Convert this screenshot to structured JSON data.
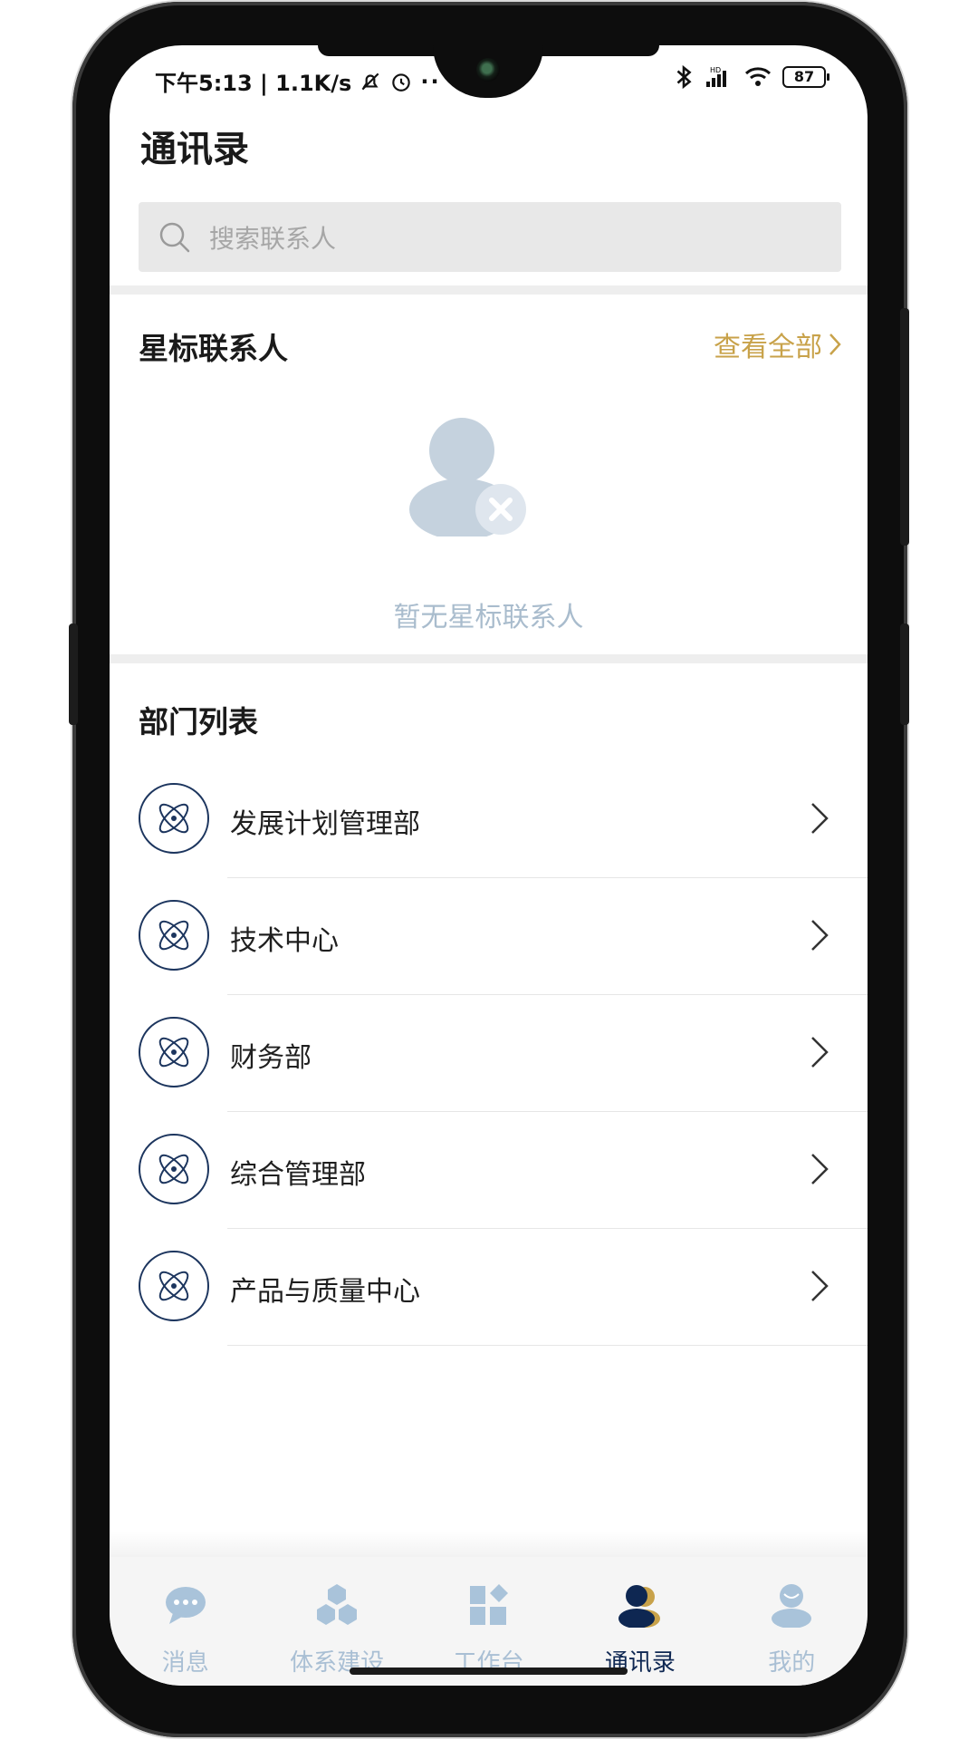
{
  "status_bar": {
    "time_speed": "下午5:13 | 1.1K/s",
    "icons": [
      "mute-bell-icon",
      "alarm-icon",
      "more-dots-icon",
      "bluetooth-icon",
      "signal-hd-icon",
      "wifi-icon"
    ],
    "battery": "87"
  },
  "header": {
    "title": "通讯录"
  },
  "search": {
    "placeholder": "搜索联系人"
  },
  "starred": {
    "title": "星标联系人",
    "view_all": "查看全部",
    "empty_text": "暂无星标联系人"
  },
  "departments": {
    "title": "部门列表",
    "items": [
      {
        "label": "发展计划管理部"
      },
      {
        "label": "技术中心"
      },
      {
        "label": "财务部"
      },
      {
        "label": "综合管理部"
      },
      {
        "label": "产品与质量中心"
      }
    ]
  },
  "tabbar": {
    "items": [
      {
        "label": "消息",
        "icon": "chat-bubble-icon",
        "active": false
      },
      {
        "label": "体系建设",
        "icon": "cubes-icon",
        "active": false
      },
      {
        "label": "工作台",
        "icon": "grid-apps-icon",
        "active": false
      },
      {
        "label": "通讯录",
        "icon": "contacts-icon",
        "active": true
      },
      {
        "label": "我的",
        "icon": "profile-icon",
        "active": false
      }
    ]
  },
  "colors": {
    "accent_gold": "#c8a24a",
    "navy": "#0e2752",
    "inactive_tab": "#a9bfd4"
  }
}
